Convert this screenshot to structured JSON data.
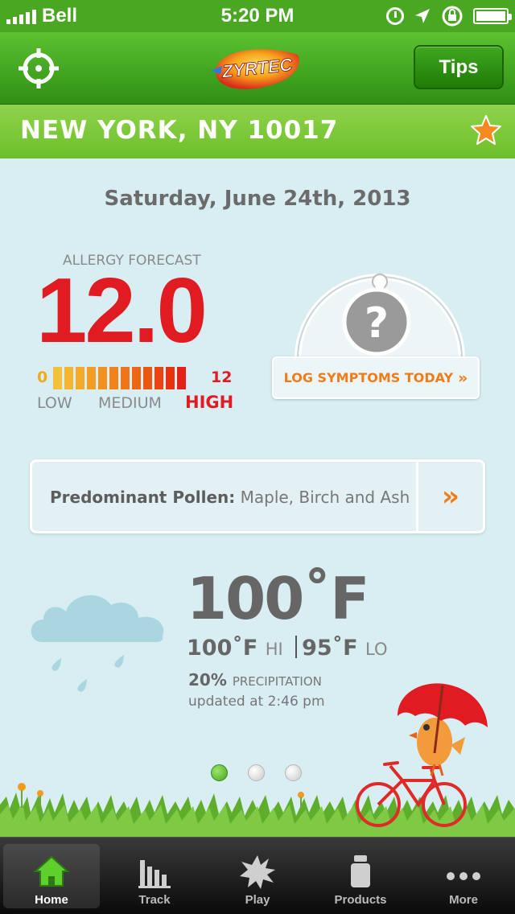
{
  "status_bar": {
    "carrier": "Bell",
    "time": "5:20 PM",
    "battery_level": 1.0
  },
  "header": {
    "logo_text": "ZYRTEC",
    "tips_label": "Tips"
  },
  "location": {
    "label": "NEW YORK, NY 10017"
  },
  "date": "Saturday, June 24th, 2013",
  "allergy": {
    "title": "ALLERGY FORECAST",
    "value": "12.0",
    "scale_min": "0",
    "scale_max": "12",
    "level_low": "LOW",
    "level_medium": "MEDIUM",
    "level_high": "HIGH",
    "bar_colors": [
      "#f6c13a",
      "#f6b530",
      "#f5a928",
      "#f49d24",
      "#f39020",
      "#f2821c",
      "#f07418",
      "#ee6614",
      "#ec5612",
      "#ea4410",
      "#e8320e",
      "#e4201a"
    ]
  },
  "symptoms": {
    "button_label": "LOG SYMPTOMS TODAY",
    "chevron": "»",
    "gauge_symbol": "?"
  },
  "pollen": {
    "label": "Predominant Pollen:",
    "value": "Maple, Birch and Ash",
    "chevron": "»"
  },
  "weather": {
    "current_temp": "100˚F",
    "high_value": "100˚F",
    "high_tag": "HI",
    "low_value": "95˚F",
    "low_tag": "LO",
    "precip_value": "20%",
    "precip_label": "PRECIPITATION",
    "updated": "updated at 2:46 pm"
  },
  "pager": {
    "count": 3,
    "active_index": 0
  },
  "tabs": [
    {
      "label": "Home",
      "icon": "home-icon",
      "active": true
    },
    {
      "label": "Track",
      "icon": "bar-chart-icon",
      "active": false
    },
    {
      "label": "Play",
      "icon": "burst-icon",
      "active": false
    },
    {
      "label": "Products",
      "icon": "bottle-icon",
      "active": false
    },
    {
      "label": "More",
      "icon": "more-dots-icon",
      "active": false
    }
  ],
  "colors": {
    "brand_green": "#4aa722",
    "alert_red": "#e11b22",
    "accent_orange": "#f07c18",
    "sky": "#d8eef3"
  }
}
